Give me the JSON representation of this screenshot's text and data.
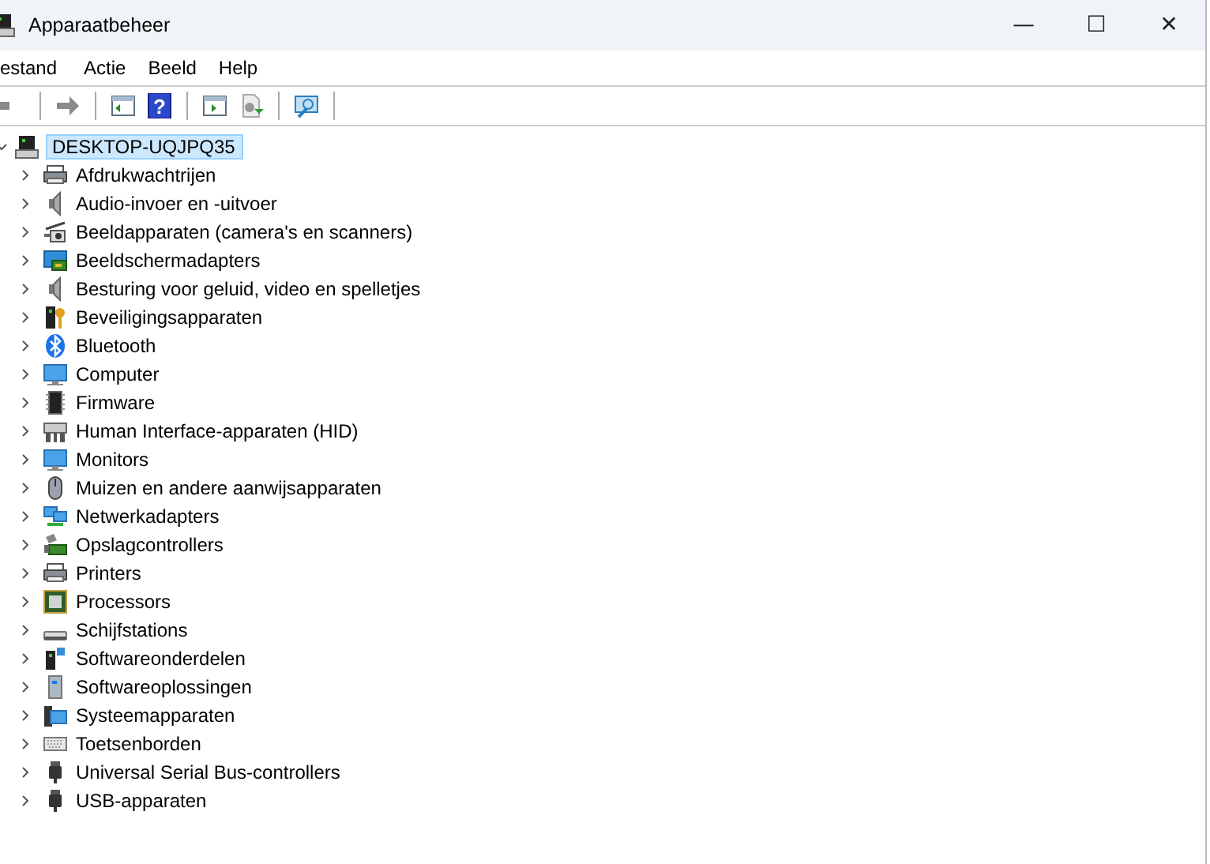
{
  "window": {
    "title": "Apparaatbeheer",
    "controls": [
      "—",
      "☐",
      "✕"
    ]
  },
  "menu": [
    "estand",
    "Actie",
    "Beeld",
    "Help"
  ],
  "toolbar": {
    "help_glyph": "?"
  },
  "tree": {
    "label": "DESKTOP-UQJPQ35",
    "expanded": true,
    "selected": true,
    "children": [
      {
        "label": "Afdrukwachtrijen",
        "kind": "printer",
        "expanded": false
      },
      {
        "label": "Audio-invoer en -uitvoer",
        "kind": "speaker",
        "expanded": false
      },
      {
        "label": "Beeldapparaten (camera's en scanners)",
        "kind": "camera",
        "expanded": false
      },
      {
        "label": "Beeldschermadapters",
        "kind": "adapter",
        "expanded": false
      },
      {
        "label": "Besturing voor geluid, video en spelletjes",
        "kind": "speaker",
        "expanded": false
      },
      {
        "label": "Beveiligingsapparaten",
        "kind": "security",
        "expanded": false
      },
      {
        "label": "Bluetooth",
        "kind": "bluetooth",
        "expanded": false
      },
      {
        "label": "Computer",
        "kind": "monitor",
        "expanded": false
      },
      {
        "label": "Firmware",
        "kind": "chip",
        "expanded": false
      },
      {
        "label": "Human Interface-apparaten (HID)",
        "kind": "hid",
        "expanded": false
      },
      {
        "label": "Monitors",
        "kind": "monitor",
        "expanded": false
      },
      {
        "label": "Muizen en andere aanwijsapparaten",
        "kind": "mouse",
        "expanded": false
      },
      {
        "label": "Netwerkadapters",
        "kind": "network",
        "expanded": false
      },
      {
        "label": "Opslagcontrollers",
        "kind": "storage",
        "expanded": false
      },
      {
        "label": "Printers",
        "kind": "printer",
        "expanded": false
      },
      {
        "label": "Processors",
        "kind": "processor",
        "expanded": false
      },
      {
        "label": "Schijfstations",
        "kind": "drive",
        "expanded": false
      },
      {
        "label": "Softwareonderdelen",
        "kind": "component",
        "expanded": false
      },
      {
        "label": "Softwareoplossingen",
        "kind": "software",
        "expanded": false
      },
      {
        "label": "Systeemapparaten",
        "kind": "system",
        "expanded": false
      },
      {
        "label": "Toetsenborden",
        "kind": "keyboard",
        "expanded": false
      },
      {
        "label": "Universal Serial Bus-controllers",
        "kind": "usb",
        "expanded": false
      },
      {
        "label": "USB-apparaten",
        "kind": "usb",
        "expanded": false
      }
    ]
  }
}
